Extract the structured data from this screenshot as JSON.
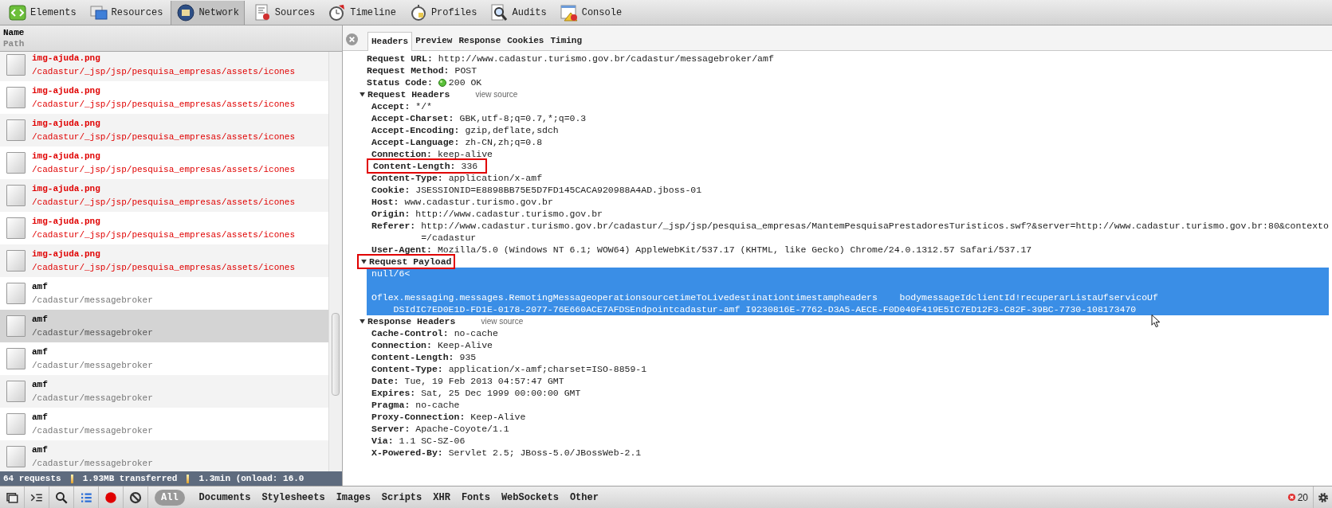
{
  "toolbar": [
    {
      "label": "Elements",
      "selected": false
    },
    {
      "label": "Resources",
      "selected": false
    },
    {
      "label": "Network",
      "selected": true
    },
    {
      "label": "Sources",
      "selected": false
    },
    {
      "label": "Timeline",
      "selected": false
    },
    {
      "label": "Profiles",
      "selected": false
    },
    {
      "label": "Audits",
      "selected": false
    },
    {
      "label": "Console",
      "selected": false
    }
  ],
  "request_list": {
    "columns": [
      "Name",
      "Path"
    ],
    "rows": [
      {
        "name": "img-ajuda.png",
        "path": "/cadastur/_jsp/jsp/pesquisa_empresas/assets/icones",
        "error": true,
        "selected": false
      },
      {
        "name": "img-ajuda.png",
        "path": "/cadastur/_jsp/jsp/pesquisa_empresas/assets/icones",
        "error": true,
        "selected": false
      },
      {
        "name": "img-ajuda.png",
        "path": "/cadastur/_jsp/jsp/pesquisa_empresas/assets/icones",
        "error": true,
        "selected": false
      },
      {
        "name": "img-ajuda.png",
        "path": "/cadastur/_jsp/jsp/pesquisa_empresas/assets/icones",
        "error": true,
        "selected": false
      },
      {
        "name": "img-ajuda.png",
        "path": "/cadastur/_jsp/jsp/pesquisa_empresas/assets/icones",
        "error": true,
        "selected": false
      },
      {
        "name": "img-ajuda.png",
        "path": "/cadastur/_jsp/jsp/pesquisa_empresas/assets/icones",
        "error": true,
        "selected": false
      },
      {
        "name": "img-ajuda.png",
        "path": "/cadastur/_jsp/jsp/pesquisa_empresas/assets/icones",
        "error": true,
        "selected": false
      },
      {
        "name": "amf",
        "path": "/cadastur/messagebroker",
        "error": false,
        "selected": false
      },
      {
        "name": "amf",
        "path": "/cadastur/messagebroker",
        "error": false,
        "selected": true
      },
      {
        "name": "amf",
        "path": "/cadastur/messagebroker",
        "error": false,
        "selected": false
      },
      {
        "name": "amf",
        "path": "/cadastur/messagebroker",
        "error": false,
        "selected": false
      },
      {
        "name": "amf",
        "path": "/cadastur/messagebroker",
        "error": false,
        "selected": false
      },
      {
        "name": "amf",
        "path": "/cadastur/messagebroker",
        "error": false,
        "selected": false
      }
    ]
  },
  "summary": [
    "64 requests",
    "1.93MB transferred",
    "1.3min (onload: 16.0"
  ],
  "detail_tabs": [
    {
      "label": "Headers",
      "selected": true
    },
    {
      "label": "Preview",
      "selected": false
    },
    {
      "label": "Response",
      "selected": false
    },
    {
      "label": "Cookies",
      "selected": false
    },
    {
      "label": "Timing",
      "selected": false
    }
  ],
  "general": [
    {
      "key": "Request URL:",
      "value": "http://www.cadastur.turismo.gov.br/cadastur/messagebroker/amf"
    },
    {
      "key": "Request Method:",
      "value": "POST"
    },
    {
      "key": "Status Code:",
      "value": "200 OK",
      "kind": "status"
    }
  ],
  "sections": [
    {
      "kind": "headers",
      "title": "Request Headers",
      "expanded": true,
      "highlighted": false,
      "link": "view source",
      "headers": [
        {
          "key": "Accept:",
          "value": "*/*",
          "highlighted": false
        },
        {
          "key": "Accept-Charset:",
          "value": "GBK,utf-8;q=0.7,*;q=0.3",
          "highlighted": false
        },
        {
          "key": "Accept-Encoding:",
          "value": "gzip,deflate,sdch",
          "highlighted": false
        },
        {
          "key": "Accept-Language:",
          "value": "zh-CN,zh;q=0.8",
          "highlighted": false
        },
        {
          "key": "Connection:",
          "value": "keep-alive",
          "highlighted": false
        },
        {
          "key": "Content-Length:",
          "value": "336",
          "highlighted": true
        },
        {
          "key": "Content-Type:",
          "value": "application/x-amf",
          "highlighted": false
        },
        {
          "key": "Cookie:",
          "value": "JSESSIONID=E8898BB75E5D7FD145CACA920988A4AD.jboss-01",
          "highlighted": false
        },
        {
          "key": "Host:",
          "value": "www.cadastur.turismo.gov.br",
          "highlighted": false
        },
        {
          "key": "Origin:",
          "value": "http://www.cadastur.turismo.gov.br",
          "highlighted": false
        },
        {
          "key": "Referer:",
          "value": "http://www.cadastur.turismo.gov.br/cadastur/_jsp/jsp/pesquisa_empresas/MantemPesquisaPrestadoresTuristicos.swf?&server=http://www.cadastur.turismo.gov.br:80&contexto=/cadastur",
          "highlighted": false
        },
        {
          "key": "User-Agent:",
          "value": "Mozilla/5.0 (Windows NT 6.1; WOW64) AppleWebKit/537.17 (KHTML, like Gecko) Chrome/24.0.1312.57 Safari/537.17",
          "highlighted": false
        }
      ]
    },
    {
      "kind": "payload",
      "title": "Request Payload",
      "expanded": true,
      "highlighted": true,
      "selected": true,
      "paragraphs": [
        [
          "null/6<"
        ],
        [
          "Oflex.messaging.messages.RemotingMessageoperationsourcetimeToLivedestinationtimestampheaders    bodymessageIdclientId!recuperarListaUfservicoUf",
          "    DSIdIC7ED0E1D-FD1E-0178-2077-76E660ACE7AFDSEndpointcadastur-amf I9230816E-7762-D3A5-AECE-F0D040F419E5IC7ED12F3-C82F-39BC-7730-108173470"
        ]
      ]
    },
    {
      "kind": "headers",
      "title": "Response Headers",
      "expanded": true,
      "highlighted": false,
      "link": "view source",
      "headers": [
        {
          "key": "Cache-Control:",
          "value": "no-cache",
          "highlighted": false
        },
        {
          "key": "Connection:",
          "value": "Keep-Alive",
          "highlighted": false
        },
        {
          "key": "Content-Length:",
          "value": "935",
          "highlighted": false
        },
        {
          "key": "Content-Type:",
          "value": "application/x-amf;charset=ISO-8859-1",
          "highlighted": false
        },
        {
          "key": "Date:",
          "value": "Tue, 19 Feb 2013 04:57:47 GMT",
          "highlighted": false
        },
        {
          "key": "Expires:",
          "value": "Sat, 25 Dec 1999 00:00:00 GMT",
          "highlighted": false
        },
        {
          "key": "Pragma:",
          "value": "no-cache",
          "highlighted": false
        },
        {
          "key": "Proxy-Connection:",
          "value": "Keep-Alive",
          "highlighted": false
        },
        {
          "key": "Server:",
          "value": "Apache-Coyote/1.1",
          "highlighted": false
        },
        {
          "key": "Via:",
          "value": "1.1 SC-SZ-06",
          "highlighted": false
        },
        {
          "key": "X-Powered-By:",
          "value": "Servlet 2.5; JBoss-5.0/JBossWeb-2.1",
          "highlighted": false
        }
      ]
    }
  ],
  "bottom_bar": {
    "recording": true,
    "filters": [
      {
        "label": "All",
        "selected": true
      },
      {
        "label": "Documents",
        "selected": false
      },
      {
        "label": "Stylesheets",
        "selected": false
      },
      {
        "label": "Images",
        "selected": false
      },
      {
        "label": "Scripts",
        "selected": false
      },
      {
        "label": "XHR",
        "selected": false
      },
      {
        "label": "Fonts",
        "selected": false
      },
      {
        "label": "WebSockets",
        "selected": false
      },
      {
        "label": "Other",
        "selected": false
      }
    ],
    "error_count": "20"
  }
}
